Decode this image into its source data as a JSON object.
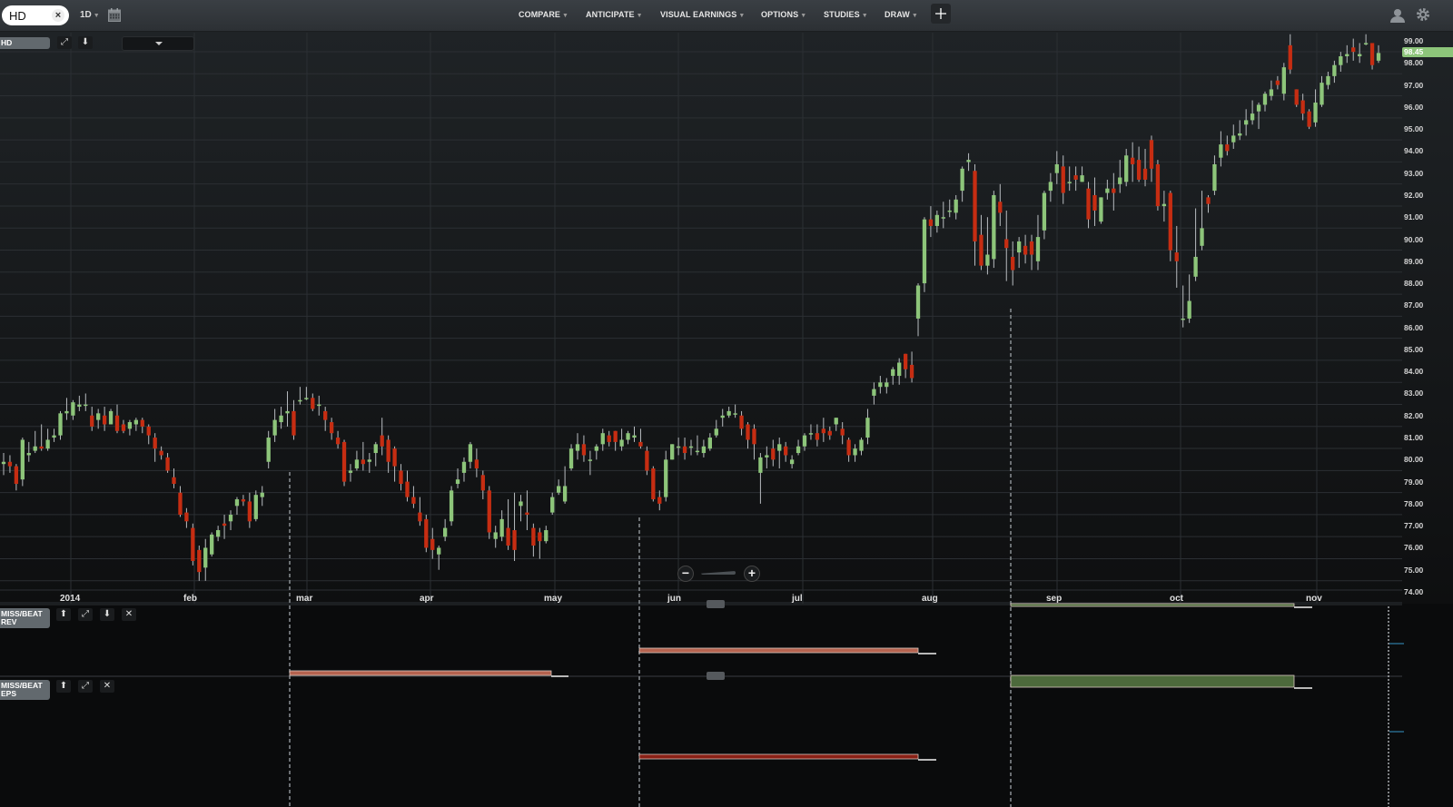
{
  "topbar": {
    "ticker": "HD",
    "interval": "1D",
    "menus": [
      "COMPARE",
      "ANTICIPATE",
      "VISUAL EARNINGS",
      "OPTIONS",
      "STUDIES",
      "DRAW"
    ]
  },
  "main_panel": {
    "label": "HD",
    "last_price": "98.45"
  },
  "panels": [
    {
      "label_line1": "MISS/BEAT",
      "label_line2": "REV"
    },
    {
      "label_line1": "MISS/BEAT",
      "label_line2": "EPS"
    }
  ],
  "colors": {
    "up": "#8dc57a",
    "down": "#c62d12",
    "beat_fill": "#4d6a3c",
    "miss_fill": "#c0392b",
    "last_price_bg": "#8dc57a"
  },
  "chart_data": {
    "type": "candlestick",
    "symbol": "HD",
    "ylim": [
      74,
      99.3
    ],
    "y_ticks": [
      "99.00",
      "98.00",
      "97.00",
      "96.00",
      "95.00",
      "94.00",
      "93.00",
      "92.00",
      "91.00",
      "90.00",
      "89.00",
      "88.00",
      "87.00",
      "86.00",
      "85.00",
      "84.00",
      "83.00",
      "82.00",
      "81.00",
      "80.00",
      "79.00",
      "78.00",
      "77.00",
      "76.00",
      "75.00",
      "74.00"
    ],
    "x_ticks": [
      "2014",
      "feb",
      "mar",
      "apr",
      "may",
      "jun",
      "jul",
      "aug",
      "sep",
      "oct",
      "nov"
    ],
    "candles": [
      [
        79.8,
        79.9,
        80.3,
        79.3
      ],
      [
        79.9,
        79.7,
        80.2,
        79.4
      ],
      [
        79.7,
        78.9,
        79.8,
        78.6
      ],
      [
        79.1,
        80.9,
        81.0,
        78.8
      ],
      [
        80.2,
        80.3,
        80.8,
        79.9
      ],
      [
        80.4,
        80.6,
        81.3,
        80.3
      ],
      [
        80.6,
        80.5,
        81.6,
        80.4
      ],
      [
        80.5,
        80.9,
        81.4,
        80.4
      ],
      [
        81.0,
        81.1,
        81.4,
        80.8
      ],
      [
        81.1,
        82.1,
        82.2,
        80.9
      ],
      [
        82.1,
        82.2,
        82.8,
        81.8
      ],
      [
        82.0,
        82.6,
        82.7,
        81.8
      ],
      [
        82.4,
        82.5,
        82.9,
        82.2
      ],
      [
        82.5,
        82.5,
        83.0,
        82.2
      ],
      [
        82.0,
        81.5,
        82.4,
        81.3
      ],
      [
        81.8,
        82.1,
        82.3,
        81.4
      ],
      [
        82.0,
        81.6,
        82.4,
        81.3
      ],
      [
        81.6,
        82.2,
        82.3,
        81.6
      ],
      [
        82.0,
        81.3,
        82.5,
        81.2
      ],
      [
        81.6,
        81.3,
        81.8,
        81.2
      ],
      [
        81.4,
        81.7,
        81.8,
        81.1
      ],
      [
        81.6,
        81.8,
        81.9,
        81.3
      ],
      [
        81.8,
        81.5,
        81.9,
        81.2
      ],
      [
        81.5,
        81.1,
        81.6,
        80.7
      ],
      [
        81.0,
        80.5,
        81.2,
        79.9
      ],
      [
        80.4,
        80.2,
        80.6,
        80.0
      ],
      [
        80.1,
        79.5,
        80.3,
        79.4
      ],
      [
        79.2,
        78.9,
        79.6,
        78.7
      ],
      [
        78.5,
        77.5,
        78.8,
        77.4
      ],
      [
        77.6,
        77.2,
        77.8,
        76.9
      ],
      [
        76.9,
        75.4,
        77.1,
        75.2
      ],
      [
        75.9,
        74.9,
        76.1,
        74.5
      ],
      [
        75.1,
        76.0,
        76.4,
        74.5
      ],
      [
        75.7,
        76.6,
        76.7,
        75.6
      ],
      [
        76.5,
        76.8,
        77.0,
        76.3
      ],
      [
        77.1,
        77.0,
        77.5,
        76.4
      ],
      [
        77.2,
        77.5,
        77.7,
        76.8
      ],
      [
        77.9,
        78.2,
        78.3,
        77.5
      ],
      [
        78.2,
        78.1,
        78.4,
        77.9
      ],
      [
        78.1,
        77.2,
        78.5,
        76.9
      ],
      [
        77.3,
        78.4,
        78.6,
        77.2
      ],
      [
        78.3,
        78.5,
        78.8,
        77.9
      ],
      [
        79.9,
        81.0,
        81.3,
        79.6
      ],
      [
        81.1,
        81.8,
        82.3,
        80.8
      ],
      [
        81.7,
        82.0,
        82.4,
        81.4
      ],
      [
        82.1,
        82.2,
        83.1,
        81.5
      ],
      [
        82.2,
        81.1,
        82.7,
        80.9
      ],
      [
        82.7,
        82.7,
        83.3,
        82.5
      ],
      [
        82.8,
        82.8,
        83.3,
        82.7
      ],
      [
        82.8,
        82.3,
        83.0,
        82.2
      ],
      [
        82.5,
        82.5,
        82.9,
        82.0
      ],
      [
        82.2,
        81.8,
        82.4,
        81.3
      ],
      [
        81.7,
        81.2,
        81.9,
        80.9
      ],
      [
        81.0,
        80.7,
        81.3,
        80.5
      ],
      [
        80.8,
        79.0,
        80.9,
        78.8
      ],
      [
        79.4,
        79.5,
        79.8,
        79.0
      ],
      [
        79.6,
        80.0,
        80.4,
        79.5
      ],
      [
        80.0,
        79.8,
        80.8,
        79.5
      ],
      [
        79.9,
        80.0,
        80.3,
        79.4
      ],
      [
        80.3,
        80.7,
        80.8,
        79.7
      ],
      [
        81.1,
        80.6,
        81.9,
        80.2
      ],
      [
        80.9,
        79.9,
        81.1,
        79.4
      ],
      [
        80.5,
        79.7,
        80.6,
        79.0
      ],
      [
        79.5,
        78.9,
        79.8,
        78.6
      ],
      [
        79.0,
        78.3,
        79.5,
        78.1
      ],
      [
        78.3,
        78.0,
        78.8,
        77.8
      ],
      [
        77.6,
        77.2,
        78.3,
        77.0
      ],
      [
        77.3,
        76.0,
        77.5,
        75.8
      ],
      [
        76.4,
        75.9,
        76.9,
        75.5
      ],
      [
        75.7,
        76.0,
        76.1,
        75.0
      ],
      [
        76.5,
        76.9,
        77.3,
        76.3
      ],
      [
        77.2,
        78.6,
        78.8,
        77.0
      ],
      [
        78.9,
        79.1,
        79.6,
        78.7
      ],
      [
        79.4,
        79.9,
        80.1,
        79.0
      ],
      [
        79.9,
        80.7,
        80.8,
        79.6
      ],
      [
        80.0,
        79.6,
        80.5,
        79.2
      ],
      [
        79.3,
        78.6,
        79.5,
        78.2
      ],
      [
        78.6,
        76.7,
        78.8,
        76.4
      ],
      [
        76.4,
        76.7,
        77.0,
        76.0
      ],
      [
        76.5,
        77.3,
        77.7,
        76.3
      ],
      [
        76.9,
        76.1,
        78.2,
        75.9
      ],
      [
        76.8,
        75.9,
        78.5,
        75.4
      ],
      [
        77.9,
        78.1,
        78.4,
        77.2
      ],
      [
        77.6,
        77.5,
        78.6,
        76.8
      ],
      [
        76.9,
        76.1,
        77.1,
        75.6
      ],
      [
        76.7,
        76.3,
        76.9,
        75.5
      ],
      [
        76.3,
        76.8,
        77.0,
        76.2
      ],
      [
        77.6,
        78.3,
        78.5,
        77.5
      ],
      [
        78.5,
        78.8,
        79.1,
        78.4
      ],
      [
        78.1,
        78.8,
        79.7,
        78.0
      ],
      [
        79.6,
        80.5,
        80.7,
        79.5
      ],
      [
        80.4,
        80.7,
        81.2,
        80.0
      ],
      [
        80.7,
        80.2,
        81.1,
        79.9
      ],
      [
        80.0,
        80.0,
        80.4,
        79.3
      ],
      [
        80.4,
        80.6,
        80.7,
        80.0
      ],
      [
        80.7,
        81.2,
        81.4,
        80.4
      ],
      [
        81.1,
        80.8,
        81.3,
        80.6
      ],
      [
        81.3,
        80.8,
        81.3,
        80.4
      ],
      [
        80.6,
        80.9,
        81.4,
        80.4
      ],
      [
        80.9,
        81.2,
        81.3,
        80.7
      ],
      [
        81.0,
        81.1,
        81.5,
        80.8
      ],
      [
        80.8,
        80.6,
        81.4,
        80.5
      ],
      [
        80.4,
        79.5,
        80.6,
        79.3
      ],
      [
        79.6,
        78.2,
        79.7,
        78.1
      ],
      [
        78.3,
        78.0,
        78.6,
        77.7
      ],
      [
        78.3,
        80.0,
        80.4,
        78.1
      ],
      [
        80.0,
        80.7,
        80.7,
        80.0
      ],
      [
        80.6,
        80.6,
        81.0,
        80.2
      ],
      [
        80.6,
        80.3,
        81.0,
        80.0
      ],
      [
        80.6,
        80.6,
        80.9,
        80.2
      ],
      [
        80.4,
        80.4,
        81.1,
        80.2
      ],
      [
        80.3,
        80.6,
        80.9,
        80.1
      ],
      [
        80.5,
        81.0,
        81.2,
        80.4
      ],
      [
        81.1,
        81.4,
        81.8,
        81.0
      ],
      [
        81.9,
        82.0,
        82.3,
        81.5
      ],
      [
        82.0,
        82.2,
        82.4,
        81.9
      ],
      [
        82.1,
        82.1,
        82.5,
        81.9
      ],
      [
        82.0,
        81.4,
        82.2,
        81.1
      ],
      [
        81.6,
        80.9,
        81.7,
        80.5
      ],
      [
        81.4,
        80.7,
        81.6,
        80.0
      ],
      [
        79.4,
        80.1,
        80.3,
        78.0
      ],
      [
        80.1,
        80.2,
        80.6,
        79.6
      ],
      [
        80.5,
        80.0,
        80.9,
        79.7
      ],
      [
        80.4,
        80.7,
        81.0,
        79.6
      ],
      [
        80.6,
        80.2,
        80.8,
        79.9
      ],
      [
        79.8,
        80.0,
        80.2,
        79.6
      ],
      [
        80.3,
        80.6,
        80.9,
        80.2
      ],
      [
        80.6,
        81.1,
        81.2,
        80.4
      ],
      [
        81.2,
        81.2,
        81.6,
        80.9
      ],
      [
        81.2,
        80.9,
        81.6,
        80.6
      ],
      [
        81.4,
        81.2,
        81.9,
        80.8
      ],
      [
        81.3,
        81.1,
        81.5,
        80.9
      ],
      [
        81.6,
        81.9,
        81.9,
        81.3
      ],
      [
        81.4,
        81.1,
        81.7,
        80.7
      ],
      [
        80.9,
        80.2,
        81.0,
        79.9
      ],
      [
        80.2,
        80.5,
        80.7,
        79.9
      ],
      [
        80.4,
        80.9,
        81.0,
        80.2
      ],
      [
        81.0,
        81.9,
        82.3,
        80.7
      ],
      [
        82.9,
        83.2,
        83.5,
        82.5
      ],
      [
        83.3,
        83.5,
        83.8,
        83.0
      ],
      [
        83.3,
        83.5,
        83.7,
        83.0
      ],
      [
        83.8,
        84.1,
        84.2,
        83.4
      ],
      [
        83.8,
        84.4,
        84.6,
        83.4
      ],
      [
        84.8,
        84.1,
        84.8,
        83.7
      ],
      [
        84.3,
        83.7,
        84.9,
        83.5
      ],
      [
        86.4,
        87.9,
        88.0,
        85.6
      ],
      [
        88.0,
        90.9,
        91.0,
        87.6
      ],
      [
        90.9,
        90.6,
        91.5,
        90.1
      ],
      [
        90.6,
        91.1,
        91.3,
        90.3
      ],
      [
        91.0,
        91.0,
        91.7,
        90.5
      ],
      [
        91.3,
        91.3,
        91.8,
        91.0
      ],
      [
        91.2,
        91.8,
        92.0,
        90.9
      ],
      [
        92.2,
        93.2,
        93.3,
        91.7
      ],
      [
        93.5,
        93.6,
        93.9,
        93.1
      ],
      [
        93.1,
        89.9,
        93.4,
        88.8
      ],
      [
        90.2,
        88.8,
        91.1,
        88.6
      ],
      [
        88.8,
        89.3,
        91.0,
        88.4
      ],
      [
        89.1,
        92.0,
        92.2,
        88.7
      ],
      [
        91.7,
        91.2,
        92.5,
        90.6
      ],
      [
        90.0,
        89.6,
        91.3,
        88.1
      ],
      [
        89.2,
        88.6,
        89.9,
        87.9
      ],
      [
        89.4,
        89.9,
        90.1,
        88.7
      ],
      [
        89.7,
        89.3,
        90.2,
        88.9
      ],
      [
        89.9,
        89.3,
        90.2,
        88.6
      ],
      [
        89.0,
        90.1,
        91.1,
        88.6
      ],
      [
        90.4,
        92.1,
        92.2,
        90.0
      ],
      [
        92.2,
        92.6,
        93.0,
        91.7
      ],
      [
        93.0,
        93.4,
        94.0,
        92.5
      ],
      [
        93.3,
        92.1,
        93.8,
        91.6
      ],
      [
        92.6,
        92.6,
        93.3,
        92.2
      ],
      [
        92.9,
        92.7,
        93.3,
        92.2
      ],
      [
        92.6,
        92.9,
        93.3,
        92.6
      ],
      [
        92.3,
        90.9,
        92.6,
        90.5
      ],
      [
        92.0,
        91.3,
        92.8,
        90.6
      ],
      [
        90.8,
        91.9,
        91.9,
        90.7
      ],
      [
        92.1,
        92.3,
        92.7,
        91.8
      ],
      [
        92.3,
        92.1,
        93.0,
        91.3
      ],
      [
        92.5,
        92.8,
        93.6,
        92.1
      ],
      [
        92.6,
        93.8,
        94.1,
        92.4
      ],
      [
        93.7,
        93.4,
        94.4,
        92.6
      ],
      [
        93.6,
        92.7,
        94.2,
        92.6
      ],
      [
        93.2,
        92.7,
        94.1,
        92.4
      ],
      [
        94.5,
        93.2,
        94.7,
        92.6
      ],
      [
        93.4,
        91.5,
        93.6,
        91.3
      ],
      [
        91.5,
        91.6,
        92.2,
        90.8
      ],
      [
        92.1,
        89.5,
        92.2,
        89.0
      ],
      [
        89.4,
        89.0,
        90.6,
        87.8
      ],
      [
        86.4,
        86.4,
        87.9,
        86.0
      ],
      [
        86.4,
        87.2,
        88.4,
        86.2
      ],
      [
        88.3,
        89.2,
        91.4,
        88.1
      ],
      [
        89.7,
        90.5,
        92.2,
        89.5
      ],
      [
        91.9,
        91.6,
        92.0,
        91.2
      ],
      [
        92.2,
        93.4,
        93.8,
        92.0
      ],
      [
        93.7,
        94.3,
        94.9,
        93.3
      ],
      [
        94.3,
        94.0,
        94.7,
        93.8
      ],
      [
        94.4,
        94.7,
        95.2,
        94.1
      ],
      [
        94.7,
        94.8,
        95.4,
        94.5
      ],
      [
        95.2,
        95.4,
        95.9,
        94.7
      ],
      [
        95.4,
        95.7,
        96.3,
        95.2
      ],
      [
        95.8,
        96.1,
        96.2,
        95.0
      ],
      [
        96.1,
        96.6,
        96.7,
        95.8
      ],
      [
        96.5,
        96.8,
        97.2,
        96.3
      ],
      [
        97.2,
        97.0,
        97.4,
        96.8
      ],
      [
        96.6,
        97.8,
        98.0,
        96.3
      ],
      [
        98.8,
        97.7,
        99.3,
        97.5
      ],
      [
        96.8,
        96.1,
        96.8,
        96.0
      ],
      [
        96.3,
        95.7,
        96.6,
        95.4
      ],
      [
        95.8,
        95.1,
        95.9,
        95.0
      ],
      [
        95.3,
        96.2,
        96.8,
        95.1
      ],
      [
        96.1,
        97.1,
        97.4,
        96.0
      ],
      [
        97.0,
        97.4,
        97.6,
        96.8
      ],
      [
        97.4,
        97.9,
        98.1,
        97.1
      ],
      [
        97.9,
        98.3,
        98.5,
        97.6
      ],
      [
        98.3,
        98.4,
        98.8,
        98.0
      ],
      [
        98.7,
        98.5,
        99.1,
        98.1
      ],
      [
        98.3,
        98.4,
        98.9,
        98.0
      ],
      [
        98.9,
        98.9,
        99.3,
        98.8
      ],
      [
        98.9,
        97.9,
        98.8,
        97.7
      ],
      [
        98.1,
        98.45,
        98.8,
        98.0
      ]
    ],
    "earnings_markers": [
      "mar",
      "jun",
      "sep"
    ],
    "miss_beat_rev": [
      {
        "period": "feb-may",
        "result": "miss"
      },
      {
        "period": "may-aug",
        "result": "miss"
      },
      {
        "period": "aug-nov",
        "result": "beat"
      }
    ],
    "miss_beat_eps": [
      {
        "period": "feb-may",
        "result": "miss"
      },
      {
        "period": "may-aug",
        "result": "miss"
      },
      {
        "period": "aug-nov",
        "result": "beat"
      }
    ]
  }
}
